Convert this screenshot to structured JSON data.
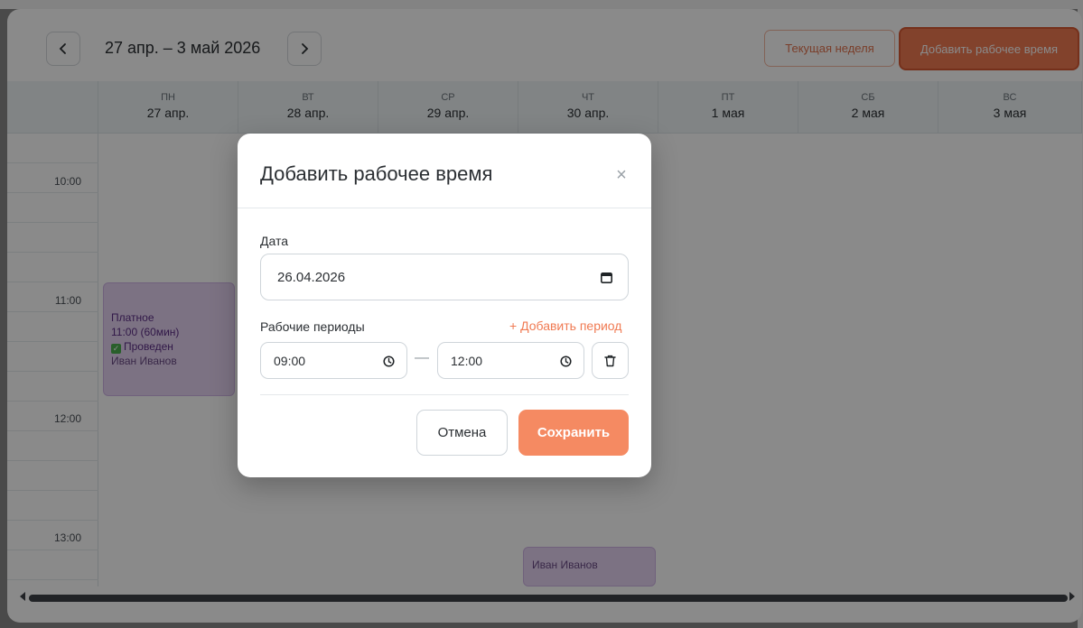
{
  "calendar": {
    "range_title": "27 апр. – 3 май 2026",
    "current_week_label": "Текущая неделя",
    "add_work_time_label": "Добавить рабочее время",
    "days": [
      {
        "dow": "ПН",
        "date": "27 апр."
      },
      {
        "dow": "ВТ",
        "date": "28 апр."
      },
      {
        "dow": "СР",
        "date": "29 апр."
      },
      {
        "dow": "ЧТ",
        "date": "30 апр."
      },
      {
        "dow": "ПТ",
        "date": "1 мая"
      },
      {
        "dow": "СБ",
        "date": "2 мая"
      },
      {
        "dow": "ВС",
        "date": "3 мая"
      }
    ],
    "times": [
      "10:00",
      "11:00",
      "12:00",
      "13:00"
    ],
    "events": [
      {
        "type": "Платное",
        "time": "11:00 (60мин)",
        "status": "Проведен",
        "customer": "Иван Иванов"
      },
      {
        "customer": "Иван Иванов"
      }
    ]
  },
  "modal": {
    "title": "Добавить рабочее время",
    "close_glyph": "×",
    "date_label": "Дата",
    "date_value": "26.04.2026",
    "periods_label": "Рабочие периоды",
    "add_period_label": "+ Добавить период",
    "period_start": "09:00",
    "period_end": "12:00",
    "dash": "—",
    "cancel_label": "Отмена",
    "save_label": "Сохранить"
  },
  "colors": {
    "accent": "#f07a52",
    "event_bg": "#e6d3f2",
    "event_text": "#5b2d86"
  }
}
